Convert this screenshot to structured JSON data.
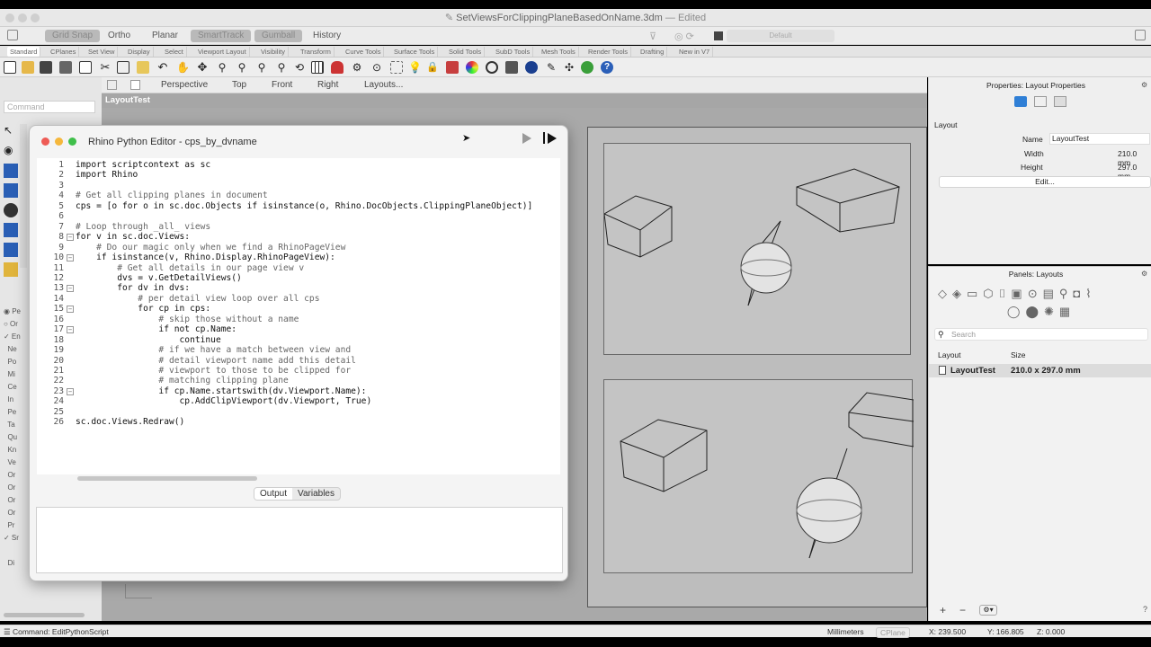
{
  "window": {
    "title": "SetViewsForClippingPlaneBasedOnName.3dm",
    "status": "— Edited"
  },
  "modebar": {
    "items": [
      "Grid Snap",
      "Ortho",
      "Planar",
      "SmartTrack",
      "Gumball",
      "History"
    ],
    "display_mode": "Default"
  },
  "tabs": [
    "Standard",
    "CPlanes",
    "Set View",
    "Display",
    "Select",
    "Viewport Layout",
    "Visibility",
    "Transform",
    "Curve Tools",
    "Surface Tools",
    "Solid Tools",
    "SubD Tools",
    "Mesh Tools",
    "Render Tools",
    "Drafting",
    "New in V7"
  ],
  "command": {
    "placeholder": "Command"
  },
  "viewport_tabs": [
    "Perspective",
    "Top",
    "Front",
    "Right",
    "Layouts..."
  ],
  "layout_tab": "LayoutTest",
  "editor": {
    "title": "Rhino Python Editor - cps_by_dvname",
    "lines": [
      {
        "n": "1",
        "t": "import scriptcontext as sc",
        "c": false
      },
      {
        "n": "2",
        "t": "import Rhino",
        "c": false
      },
      {
        "n": "3",
        "t": "",
        "c": false
      },
      {
        "n": "4",
        "t": "# Get all clipping planes in document",
        "c": true
      },
      {
        "n": "5",
        "t": "cps = [o for o in sc.doc.Objects if isinstance(o, Rhino.DocObjects.ClippingPlaneObject)]",
        "c": false
      },
      {
        "n": "6",
        "t": "",
        "c": false
      },
      {
        "n": "7",
        "t": "# Loop through _all_ views",
        "c": true
      },
      {
        "n": "8",
        "t": "for v in sc.doc.Views:",
        "c": false
      },
      {
        "n": "9",
        "t": "    # Do our magic only when we find a RhinoPageView",
        "c": true
      },
      {
        "n": "10",
        "t": "    if isinstance(v, Rhino.Display.RhinoPageView):",
        "c": false
      },
      {
        "n": "11",
        "t": "        # Get all details in our page view v",
        "c": true
      },
      {
        "n": "12",
        "t": "        dvs = v.GetDetailViews()",
        "c": false
      },
      {
        "n": "13",
        "t": "        for dv in dvs:",
        "c": false
      },
      {
        "n": "14",
        "t": "            # per detail view loop over all cps",
        "c": true
      },
      {
        "n": "15",
        "t": "            for cp in cps:",
        "c": false
      },
      {
        "n": "16",
        "t": "                # skip those without a name",
        "c": true
      },
      {
        "n": "17",
        "t": "                if not cp.Name:",
        "c": false
      },
      {
        "n": "18",
        "t": "                    continue",
        "c": false
      },
      {
        "n": "19",
        "t": "                # if we have a match between view and",
        "c": true
      },
      {
        "n": "20",
        "t": "                # detail viewport name add this detail",
        "c": true
      },
      {
        "n": "21",
        "t": "                # viewport to those to be clipped for",
        "c": true
      },
      {
        "n": "22",
        "t": "                # matching clipping plane",
        "c": true
      },
      {
        "n": "23",
        "t": "                if cp.Name.startswith(dv.Viewport.Name):",
        "c": false
      },
      {
        "n": "24",
        "t": "                    cp.AddClipViewport(dv.Viewport, True)",
        "c": false
      },
      {
        "n": "25",
        "t": "",
        "c": false
      },
      {
        "n": "26",
        "t": "sc.doc.Views.Redraw()",
        "c": false
      }
    ],
    "output_tab": "Output",
    "variables_tab": "Variables"
  },
  "properties": {
    "header": "Properties: Layout Properties",
    "section": "Layout",
    "name_label": "Name",
    "name_value": "LayoutTest",
    "width_label": "Width",
    "width_value": "210.0 mm",
    "height_label": "Height",
    "height_value": "297.0 mm",
    "edit_button": "Edit..."
  },
  "layouts_panel": {
    "header": "Panels: Layouts",
    "search_placeholder": "Search",
    "col_layout": "Layout",
    "col_size": "Size",
    "rows": [
      {
        "name": "LayoutTest",
        "size": "210.0 x 297.0 mm"
      }
    ]
  },
  "status": {
    "command": "Command: EditPythonScript",
    "units": "Millimeters",
    "cplane": "CPlane",
    "x": "X: 239.500",
    "y": "Y: 166.805",
    "z": "Z: 0.000"
  }
}
